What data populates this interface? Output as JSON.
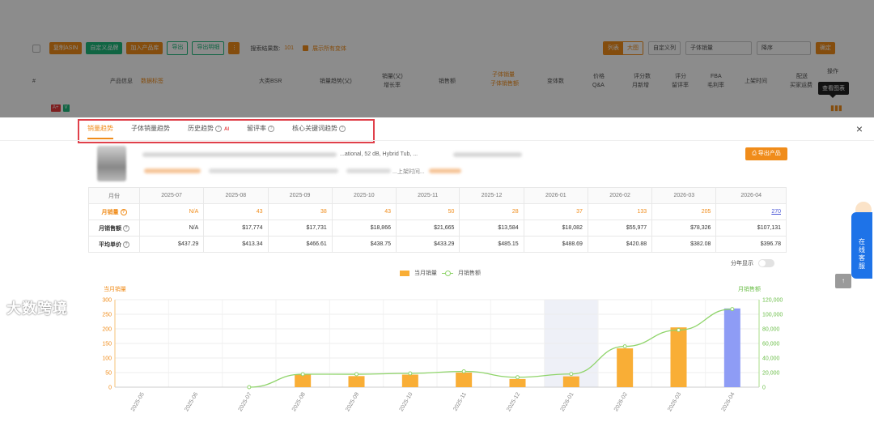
{
  "toolbar": {
    "buttons": [
      "复制ASIN",
      "自定义品牌",
      "加入产品库",
      "导出",
      "导出明细"
    ],
    "more_label": "⋮",
    "result_label": "搜索结果数:",
    "result_count": "101",
    "show_variants_label": "展示所有变体",
    "view_list": "列表",
    "view_grid": "大图",
    "custom_columns": "自定义列",
    "sort_field": "子体销量",
    "sort_order": "降序",
    "confirm": "确定"
  },
  "table_header": {
    "cols": [
      "#",
      "产品信息",
      "数据标签",
      "大类BSR",
      "销量趋势(父)",
      "销量(父)",
      "增长率",
      "销售额",
      "子体销量",
      "子体销售额",
      "变体数",
      "价格",
      "Q&A",
      "评分数",
      "月新增",
      "评分",
      "留评率",
      "FBA",
      "毛利率",
      "上架时间",
      "配送",
      "买家运费",
      "操作"
    ]
  },
  "row_badges": [
    "A+",
    "V"
  ],
  "tooltip": "查看图表",
  "modal": {
    "tabs": [
      {
        "label": "销量趋势"
      },
      {
        "label": "子体销量趋势"
      },
      {
        "label": "历史趋势",
        "ai": "AI"
      },
      {
        "label": "留评率"
      },
      {
        "label": "核心关键词趋势"
      }
    ],
    "close_label": "×",
    "product_title_fragment": "...ational, 52 dB, Hybrid Tub, ...",
    "product_sub_fragment": "...上架时间...",
    "export_label": "导出产品"
  },
  "monthly_table": {
    "header_label": "月份",
    "months": [
      "2025-07",
      "2025-08",
      "2025-09",
      "2025-10",
      "2025-11",
      "2025-12",
      "2026-01",
      "2026-02",
      "2026-03",
      "2026-04"
    ],
    "rows": [
      {
        "label": "月销量",
        "values": [
          "N/A",
          "43",
          "38",
          "43",
          "50",
          "28",
          "37",
          "133",
          "205",
          "270"
        ]
      },
      {
        "label": "月销售额",
        "values": [
          "N/A",
          "$17,774",
          "$17,731",
          "$18,866",
          "$21,665",
          "$13,584",
          "$18,082",
          "$55,977",
          "$78,326",
          "$107,131"
        ]
      },
      {
        "label": "平均单价",
        "values": [
          "$437.29",
          "$413.34",
          "$466.61",
          "$438.75",
          "$433.29",
          "$485.15",
          "$488.69",
          "$420.88",
          "$382.08",
          "$396.78"
        ]
      }
    ]
  },
  "year_toggle_label": "分年显示",
  "chart_data": {
    "type": "bar",
    "left_axis_label": "当月销量",
    "right_axis_label": "月销售额",
    "categories": [
      "2025-05",
      "2025-06",
      "2025-07",
      "2025-08",
      "2025-09",
      "2025-10",
      "2025-11",
      "2025-12",
      "2026-01",
      "2026-02",
      "2026-03",
      "2026-04"
    ],
    "series": [
      {
        "name": "当月销量",
        "type": "bar",
        "axis": "left",
        "values": [
          0,
          0,
          0,
          43,
          38,
          43,
          50,
          28,
          37,
          133,
          205,
          270
        ],
        "color": "#f9ae36",
        "last_color": "#8e9cf5"
      },
      {
        "name": "月销售额",
        "type": "line",
        "axis": "right",
        "values": [
          null,
          null,
          0,
          17774,
          17731,
          18866,
          21665,
          13584,
          18082,
          55977,
          78326,
          107131
        ],
        "color": "#8fd46a"
      }
    ],
    "ylim_left": [
      0,
      300
    ],
    "yticks_left": [
      0,
      50,
      100,
      150,
      200,
      250,
      300
    ],
    "ylim_right": [
      0,
      120000
    ],
    "yticks_right": [
      "0",
      "20,000",
      "40,000",
      "60,000",
      "80,000",
      "100,000",
      "120,000"
    ],
    "highlight_category": "2026-01",
    "grid": true,
    "legend": "top-center"
  },
  "float_top_label": "↑",
  "service_label": "在线客服",
  "watermark": "大数跨境"
}
